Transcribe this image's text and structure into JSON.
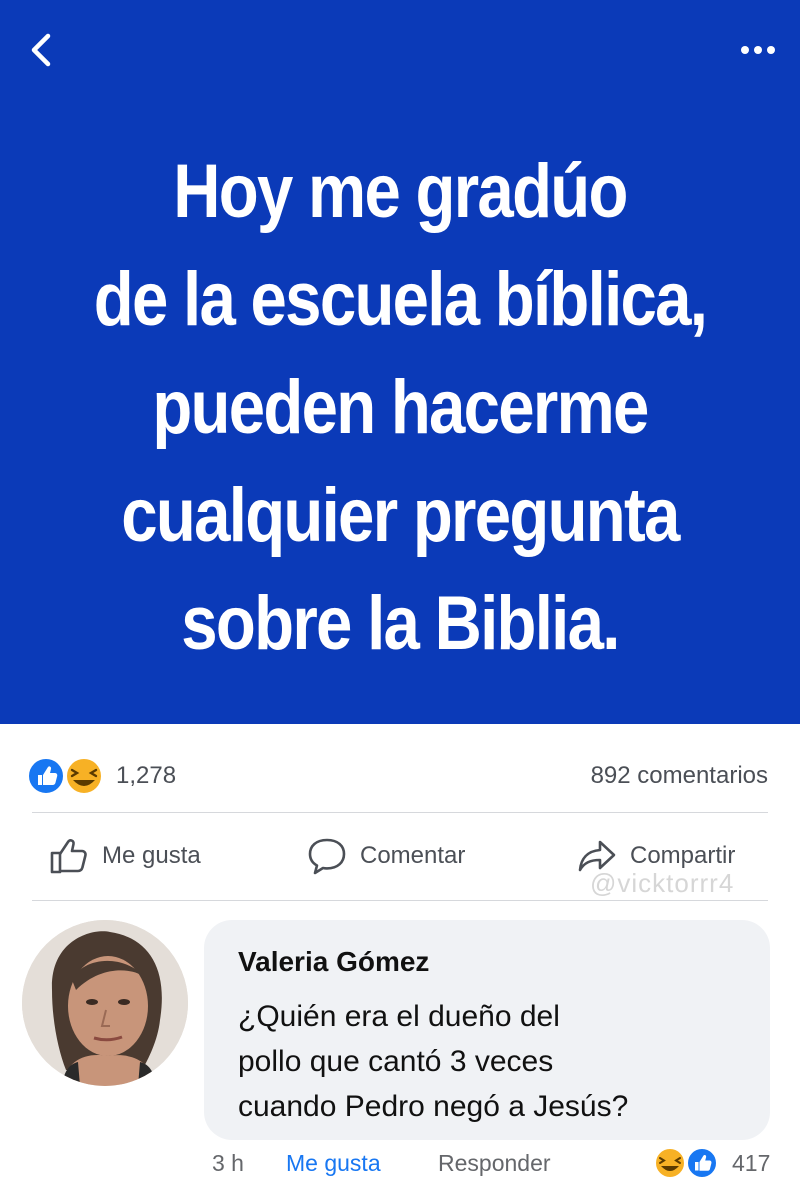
{
  "header": {
    "back_icon": "chevron-left-icon",
    "more_icon": "more-horizontal-icon"
  },
  "post": {
    "text_lines": [
      "Hoy me gradúo",
      "de la escuela bíblica,",
      "pueden hacerme",
      "cualquier pregunta",
      "sobre la Biblia."
    ],
    "background_color": "#0b3ab8"
  },
  "stats": {
    "reaction_icons": [
      "like-reaction-icon",
      "haha-reaction-icon"
    ],
    "reaction_count": "1,278",
    "comment_count": "892 comentarios"
  },
  "actions": {
    "like_label": "Me gusta",
    "comment_label": "Comentar",
    "share_label": "Compartir"
  },
  "watermark": "@vicktorrr4",
  "comment": {
    "author": "Valeria Gómez",
    "text_lines": [
      "¿Quién era el dueño del",
      "pollo que cantó 3 veces",
      "cuando Pedro negó a Jesús?"
    ],
    "time": "3 h",
    "like_label": "Me gusta",
    "reply_label": "Responder",
    "reaction_icons": [
      "haha-reaction-icon",
      "like-reaction-icon"
    ],
    "reaction_count": "417"
  },
  "colors": {
    "accent": "#1877f2",
    "haha": "#f7b125"
  }
}
